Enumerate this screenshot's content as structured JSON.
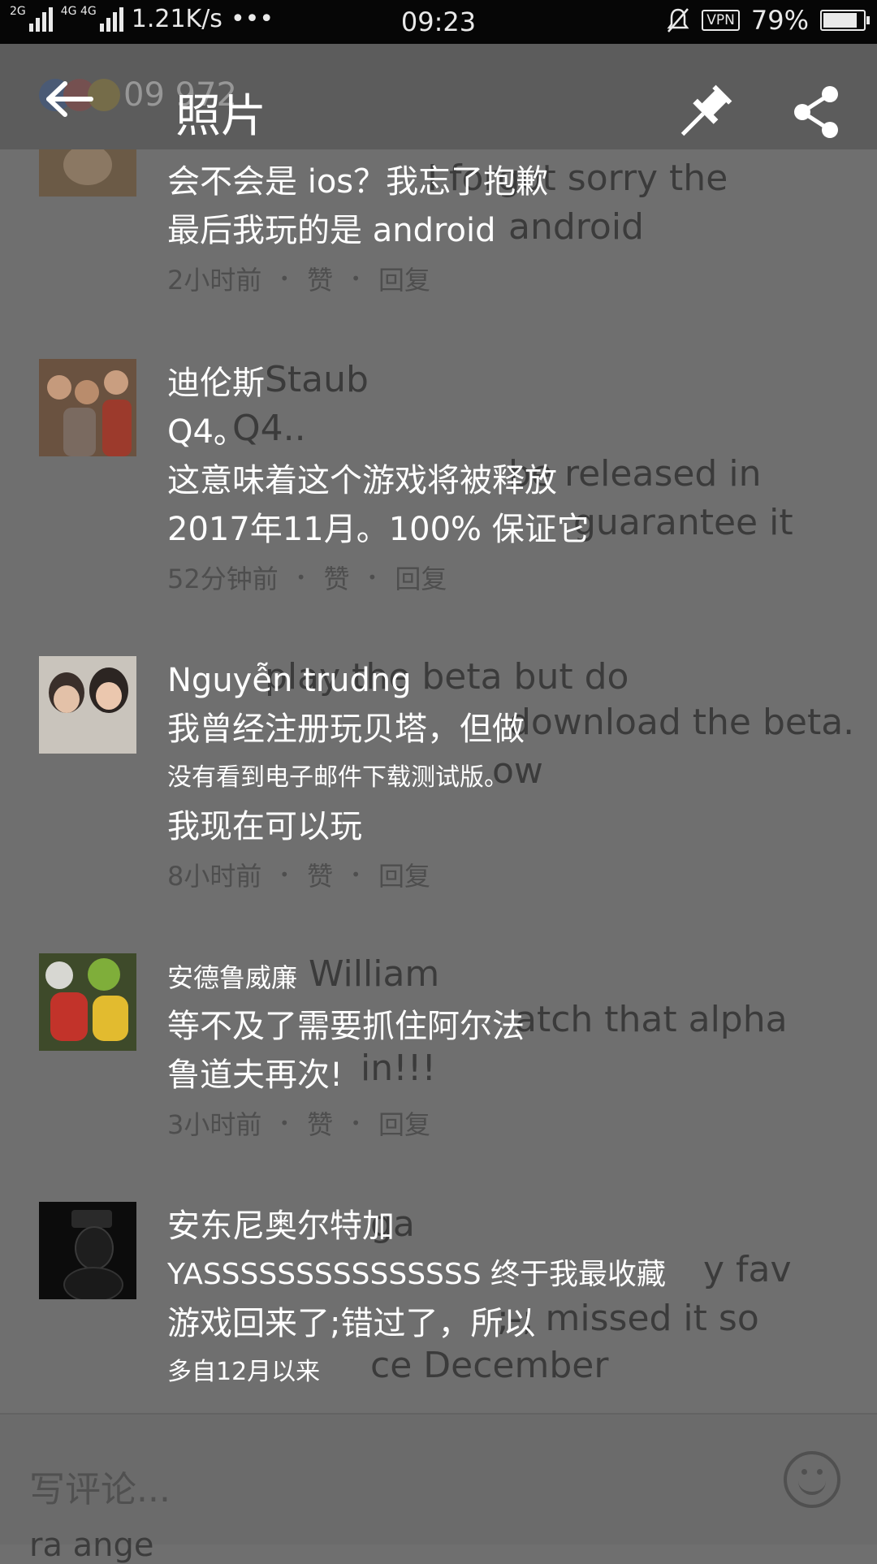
{
  "status_bar": {
    "network_tag1": "2G",
    "network_tag2": "4G 4G",
    "speed": "1.21K/s",
    "more": "•••",
    "time": "09:23",
    "vpn": "VPN",
    "battery": "79%"
  },
  "header": {
    "ghost_count": "09 972",
    "title": "照片"
  },
  "comments": [
    {
      "name": "",
      "lines": [
        "会不会是 ios？我忘了抱歉",
        "最后我玩的是 android"
      ],
      "ghost": [
        "I forgot sorry the",
        "android"
      ],
      "time": "2小时前",
      "like": "赞",
      "reply": "回复"
    },
    {
      "name": "迪伦斯",
      "lines": [
        "Q4。",
        "这意味着这个游戏将被释放",
        "2017年11月。100% 保证它"
      ],
      "ghost": [
        "Staub",
        "Q4..",
        "be released in",
        "guarantee it"
      ],
      "time": "52分钟前",
      "like": "赞",
      "reply": "回复"
    },
    {
      "name": "Nguyễn trudng",
      "lines": [
        "我曾经注册玩贝塔，但做",
        "没有看到电子邮件下载测试版。",
        "我现在可以玩"
      ],
      "ghost": [
        "play the beta but do",
        "download the beta.",
        "ow"
      ],
      "time": "8小时前",
      "like": "赞",
      "reply": "回复"
    },
    {
      "name": "安德鲁威廉",
      "lines": [
        "等不及了需要抓住阿尔法",
        "鲁道夫再次!"
      ],
      "ghost": [
        "William",
        "atch that  alpha",
        "in!!!"
      ],
      "time": "3小时前",
      "like": "赞",
      "reply": "回复"
    },
    {
      "name": "安东尼奥尔特加",
      "lines": [
        "YASSSSSSSSSSSSSSS 终于我最收藏",
        "游戏回来了;错过了，所以",
        "多自12月以来"
      ],
      "ghost": [
        "ga",
        "y fav",
        ";-; missed it so",
        "ce December"
      ]
    }
  ],
  "input": {
    "placeholder": "写评论...",
    "bottom_ghost": "ra ange"
  }
}
